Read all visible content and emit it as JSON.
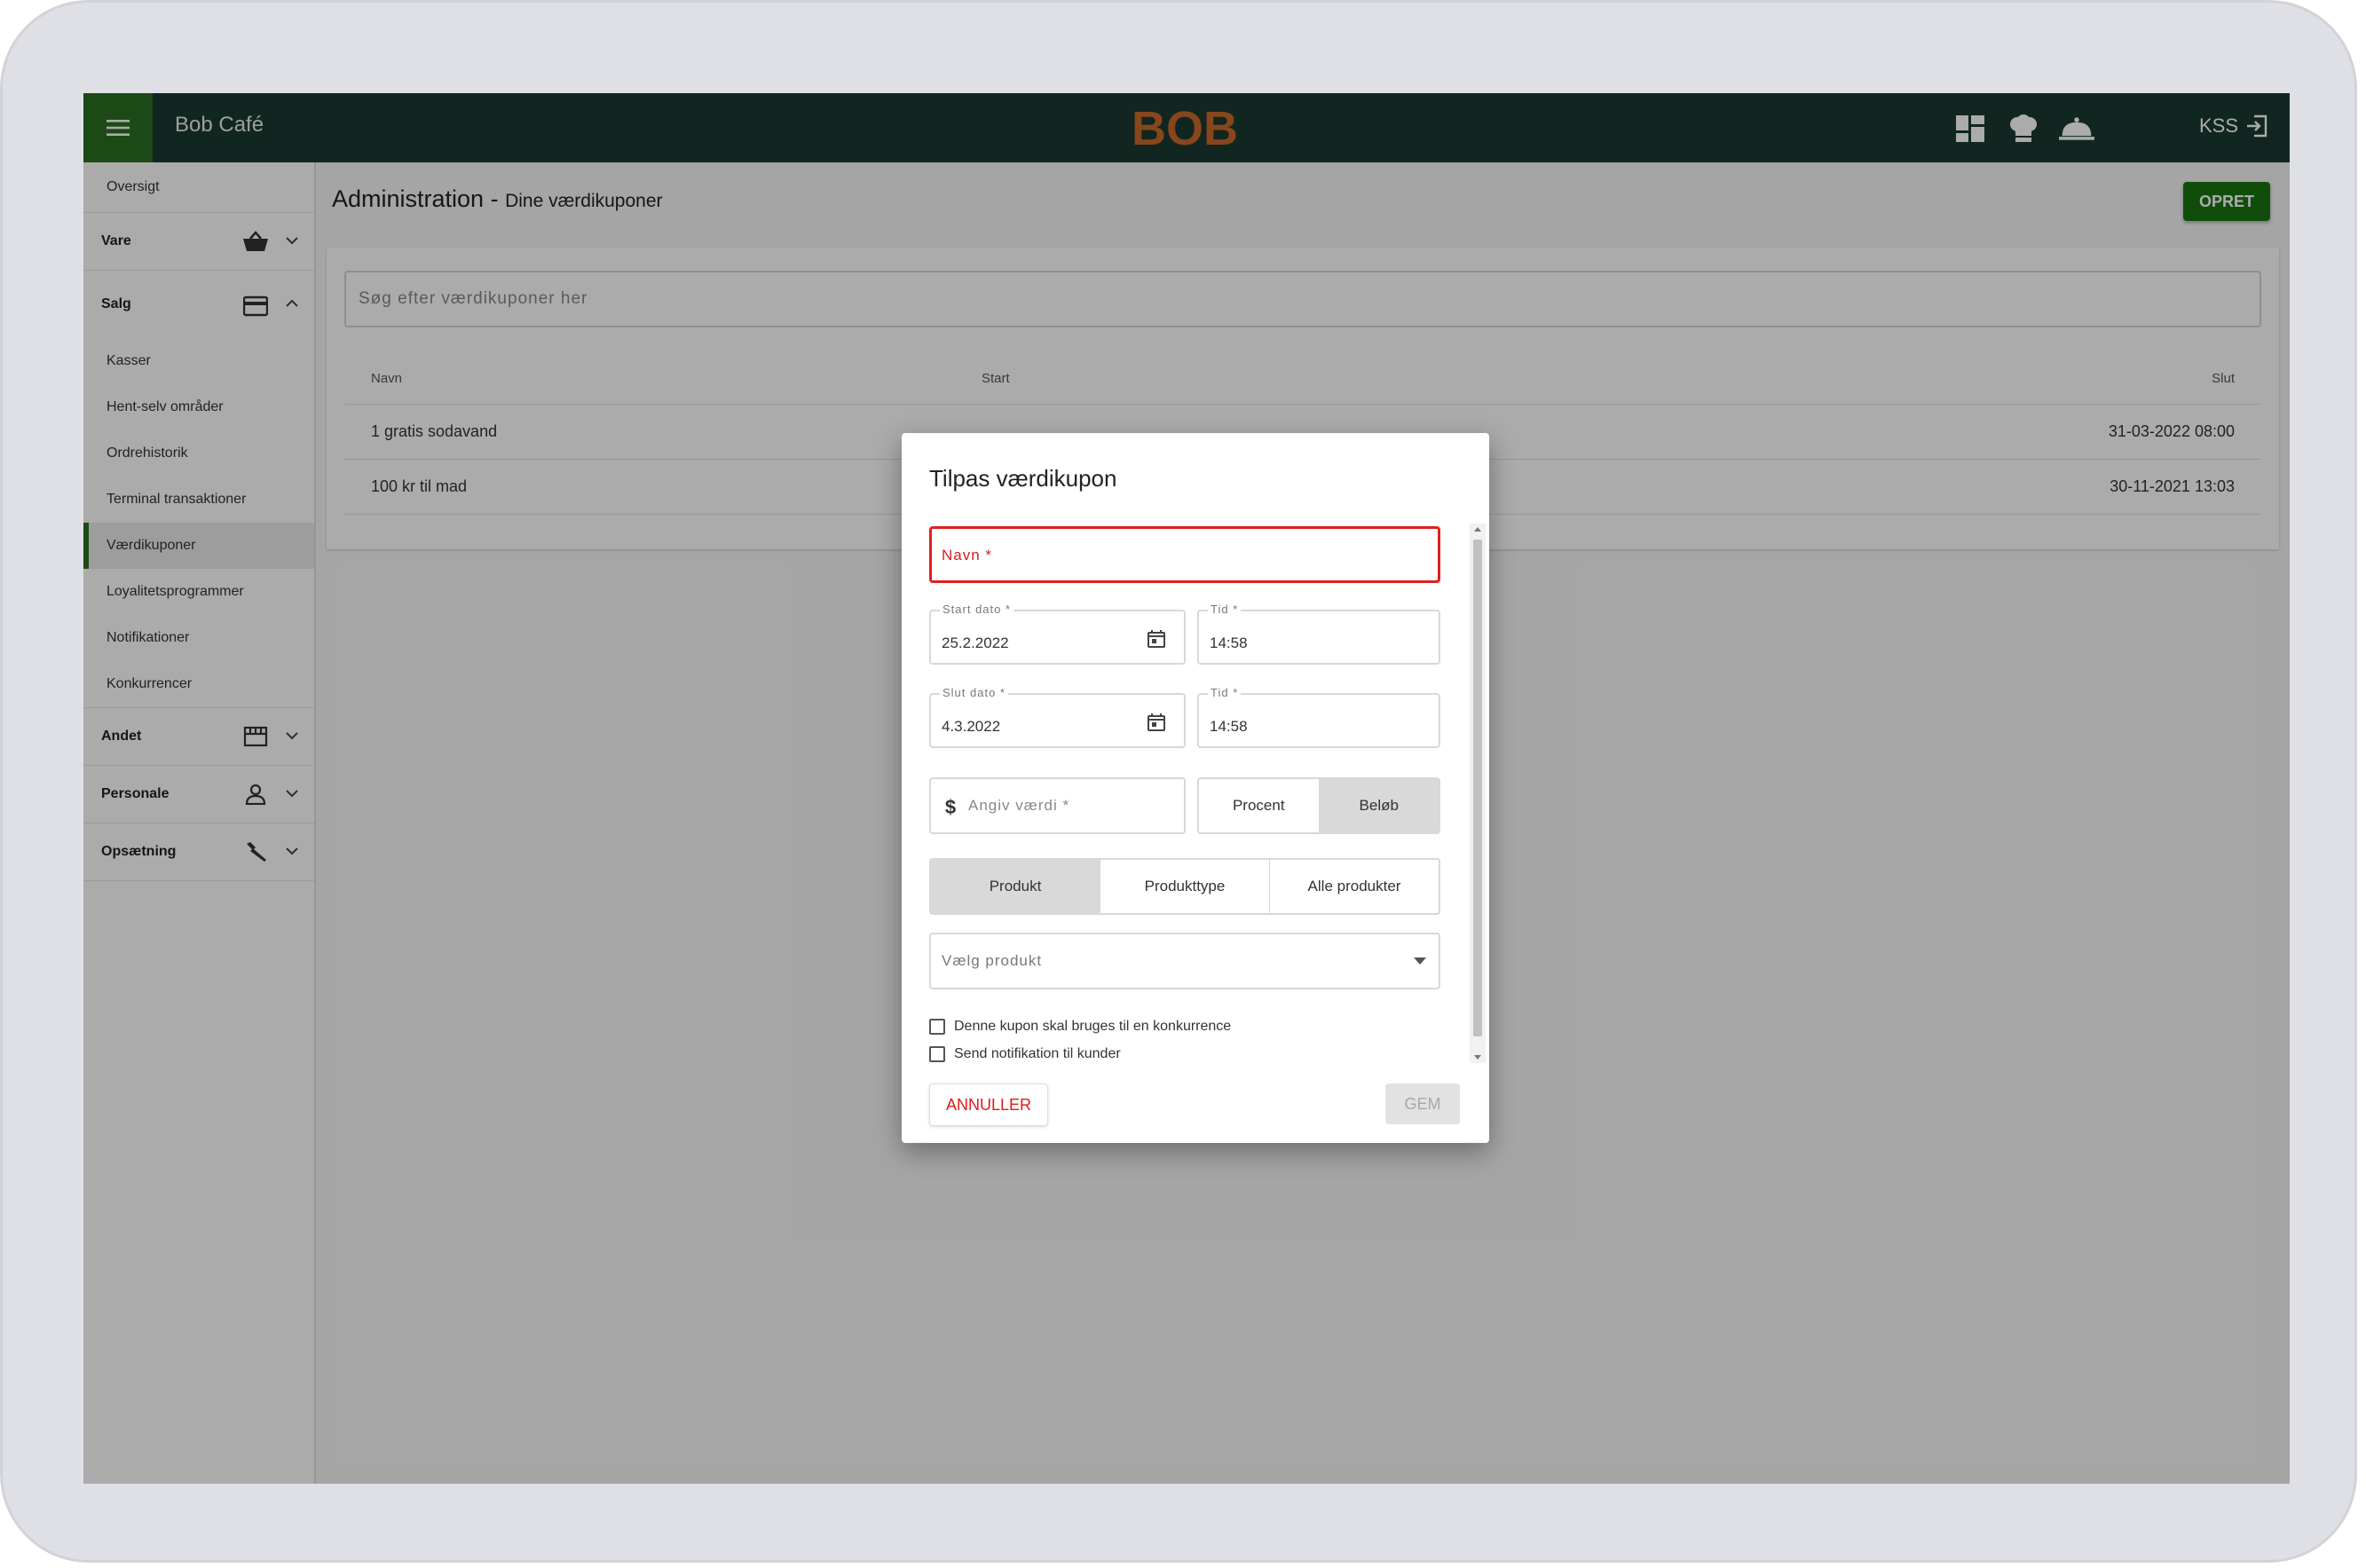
{
  "header": {
    "cafe_name": "Bob Café",
    "logo_text": "BOB",
    "user": "KSS",
    "colors": {
      "bar": "#1a3a31",
      "menu": "#2a6f22",
      "logo": "#c9692a"
    },
    "icons": [
      "dashboard-icon",
      "chef-hat-icon",
      "service-bell-icon"
    ]
  },
  "sidebar": {
    "oversigt": "Oversigt",
    "groups": {
      "vare": "Vare",
      "salg": "Salg",
      "andet": "Andet",
      "personale": "Personale",
      "opsaetning": "Opsætning"
    },
    "salg_items": [
      "Kasser",
      "Hent-selv områder",
      "Ordrehistorik",
      "Terminal transaktioner",
      "Værdikuponer",
      "Loyalitetsprogrammer",
      "Notifikationer",
      "Konkurrencer"
    ],
    "active": "Værdikuponer"
  },
  "page": {
    "title": "Administration -",
    "subtitle": "Dine værdikuponer",
    "create_button": "OPRET",
    "search_placeholder": "Søg efter værdikuponer her",
    "columns": {
      "navn": "Navn",
      "start": "Start",
      "slut": "Slut"
    },
    "rows": [
      {
        "navn": "1 gratis sodavand",
        "slut": "31-03-2022 08:00"
      },
      {
        "navn": "100 kr til mad",
        "slut": "30-11-2021 13:03"
      }
    ]
  },
  "modal": {
    "title": "Tilpas værdikupon",
    "navn_placeholder": "Navn *",
    "start_date_label": "Start dato *",
    "start_date_value": "25.2.2022",
    "start_time_label": "Tid *",
    "start_time_value": "14:58",
    "end_date_label": "Slut dato *",
    "end_date_value": "4.3.2022",
    "end_time_label": "Tid *",
    "end_time_value": "14:58",
    "value_placeholder": "Angiv værdi *",
    "value_type": {
      "procent": "Procent",
      "belob": "Beløb",
      "selected": "Beløb"
    },
    "scope": {
      "produkt": "Produkt",
      "produkttype": "Produkttype",
      "alle": "Alle produkter",
      "selected": "Produkt"
    },
    "product_placeholder": "Vælg produkt",
    "checkbox_competition": "Denne kupon skal bruges til en konkurrence",
    "checkbox_notify": "Send notifikation til kunder",
    "cancel_button": "ANNULLER",
    "save_button": "GEM"
  }
}
